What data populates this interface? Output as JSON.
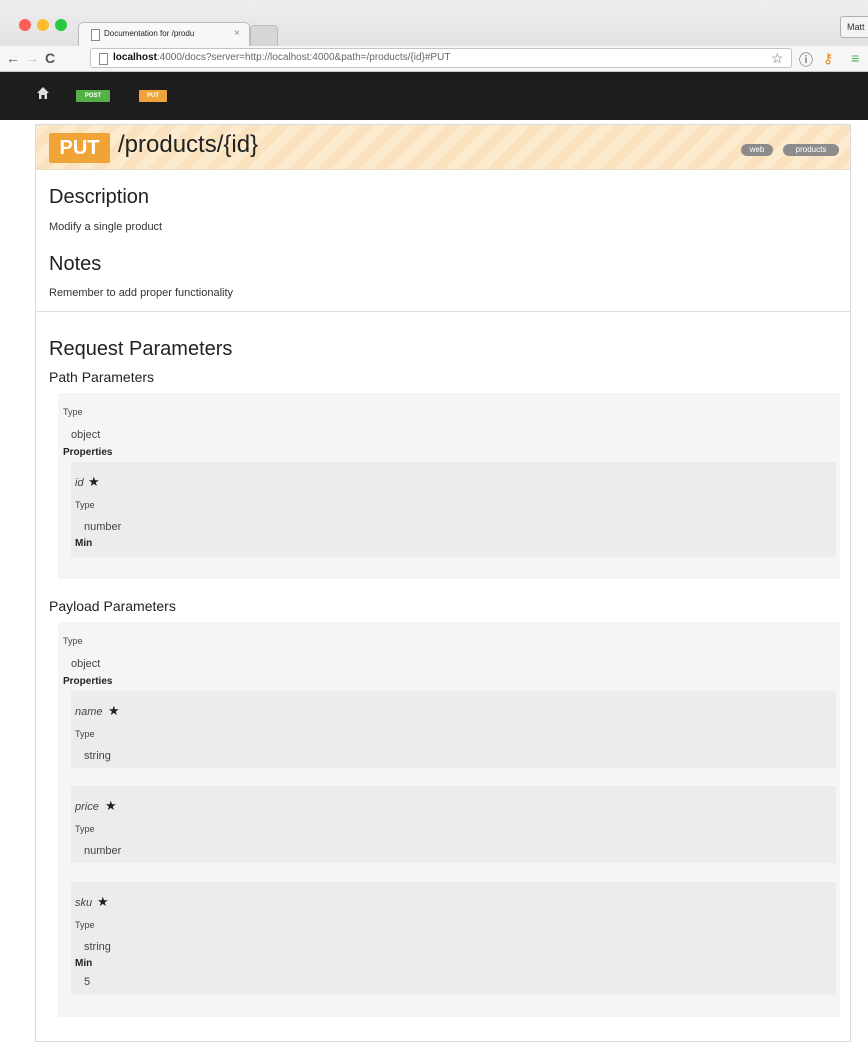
{
  "browser": {
    "tab_title": "Documentation for /produ",
    "tab_close": "×",
    "profile_label": "Matt",
    "url_host": "localhost",
    "url_rest": ":4000/docs?server=http://localhost:4000&path=/products/{id}#PUT",
    "icons": [
      "back-icon",
      "forward-icon",
      "reload-icon",
      "page-icon",
      "star-icon",
      "info-icon",
      "key-icon",
      "menu-icon"
    ]
  },
  "app_nav": {
    "post_label": "POST",
    "put_label": "PUT",
    "colors": {
      "background": "#1d1d1d",
      "post": "#55b047",
      "put": "#f0a437"
    }
  },
  "endpoint": {
    "method": "PUT",
    "path": "/products/{id}",
    "tags": [
      "web",
      "products"
    ],
    "method_color": "#f0a437"
  },
  "description": {
    "heading": "Description",
    "text": "Modify a single product"
  },
  "notes": {
    "heading": "Notes",
    "text": "Remember to add proper functionality"
  },
  "request_parameters": {
    "heading": "Request Parameters",
    "path_parameters": {
      "heading": "Path Parameters",
      "type_label": "Type",
      "type_value": "object",
      "properties_label": "Properties",
      "properties": [
        {
          "name": "id",
          "required": "★",
          "type_label": "Type",
          "type_value": "number",
          "min_label": "Min"
        }
      ]
    },
    "payload_parameters": {
      "heading": "Payload Parameters",
      "type_label": "Type",
      "type_value": "object",
      "properties_label": "Properties",
      "properties": [
        {
          "name": "name",
          "required": "★",
          "type_label": "Type",
          "type_value": "string"
        },
        {
          "name": "price",
          "required": "★",
          "type_label": "Type",
          "type_value": "number"
        },
        {
          "name": "sku",
          "required": "★",
          "type_label": "Type",
          "type_value": "string",
          "min_label": "Min",
          "min_value": "5"
        }
      ]
    }
  }
}
